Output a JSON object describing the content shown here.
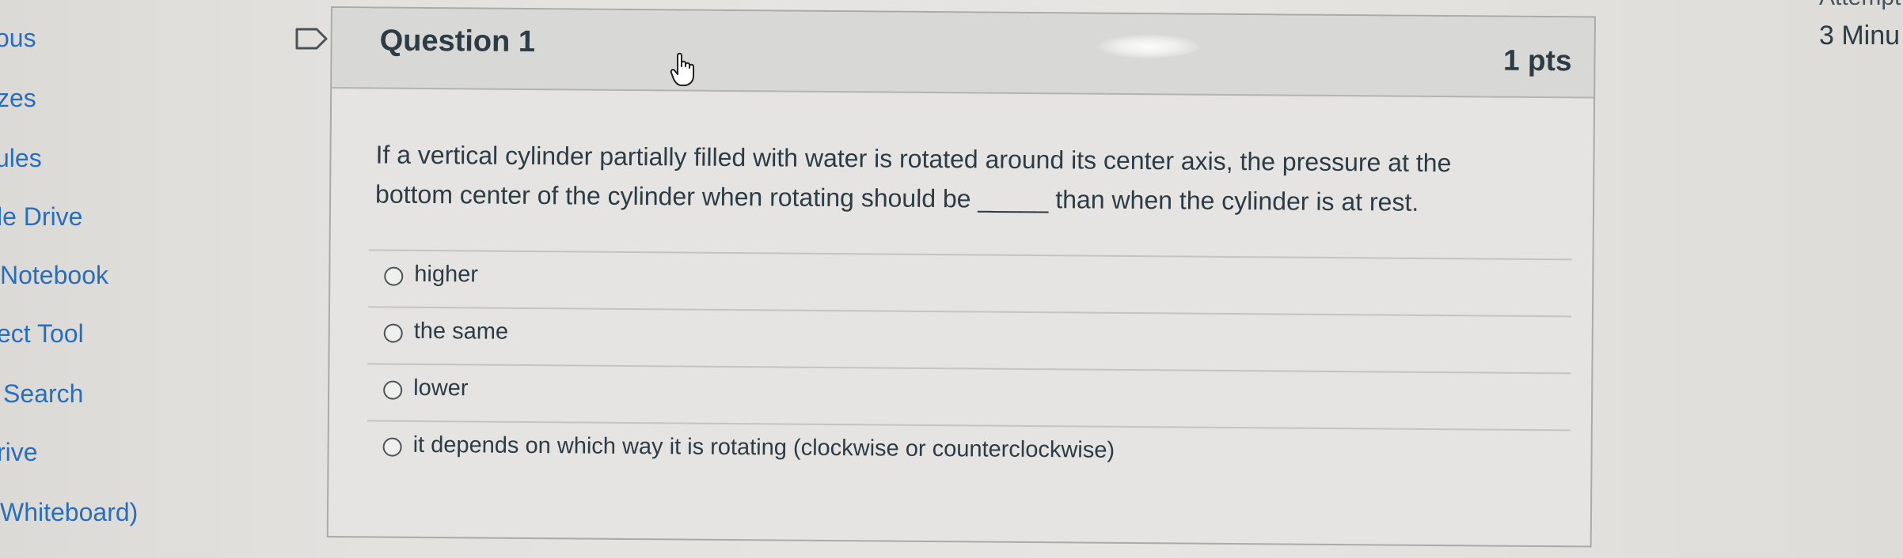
{
  "nav": {
    "items": [
      {
        "label": "ous"
      },
      {
        "label": "zes"
      },
      {
        "label": "ules"
      },
      {
        "label": "le Drive"
      },
      {
        "label": "Notebook"
      },
      {
        "label": "ect Tool"
      },
      {
        "label": "Search"
      },
      {
        "label": "rive"
      },
      {
        "label": "Whiteboard)"
      }
    ]
  },
  "header_right": {
    "attempt_text": "Attempt",
    "time_text": "3 Minu"
  },
  "question": {
    "title": "Question 1",
    "points": "1 pts",
    "text_line1": "If a vertical cylinder partially filled with water is rotated around its center axis, the pressure at the",
    "text_line2": "bottom center of the cylinder when rotating should be _____ than when the cylinder is at rest.",
    "answers": [
      {
        "label": "higher"
      },
      {
        "label": "the same"
      },
      {
        "label": "lower"
      },
      {
        "label": "it depends on which way it is rotating (clockwise or counterclockwise)"
      }
    ]
  },
  "icons": {
    "flag": "bookmark-flag-icon",
    "cursor": "hand-pointer-icon",
    "radio": "radio-button-icon"
  },
  "colors": {
    "link": "#2a6ebb",
    "text": "#2d3b45",
    "header_bg": "#d8d8d6"
  }
}
